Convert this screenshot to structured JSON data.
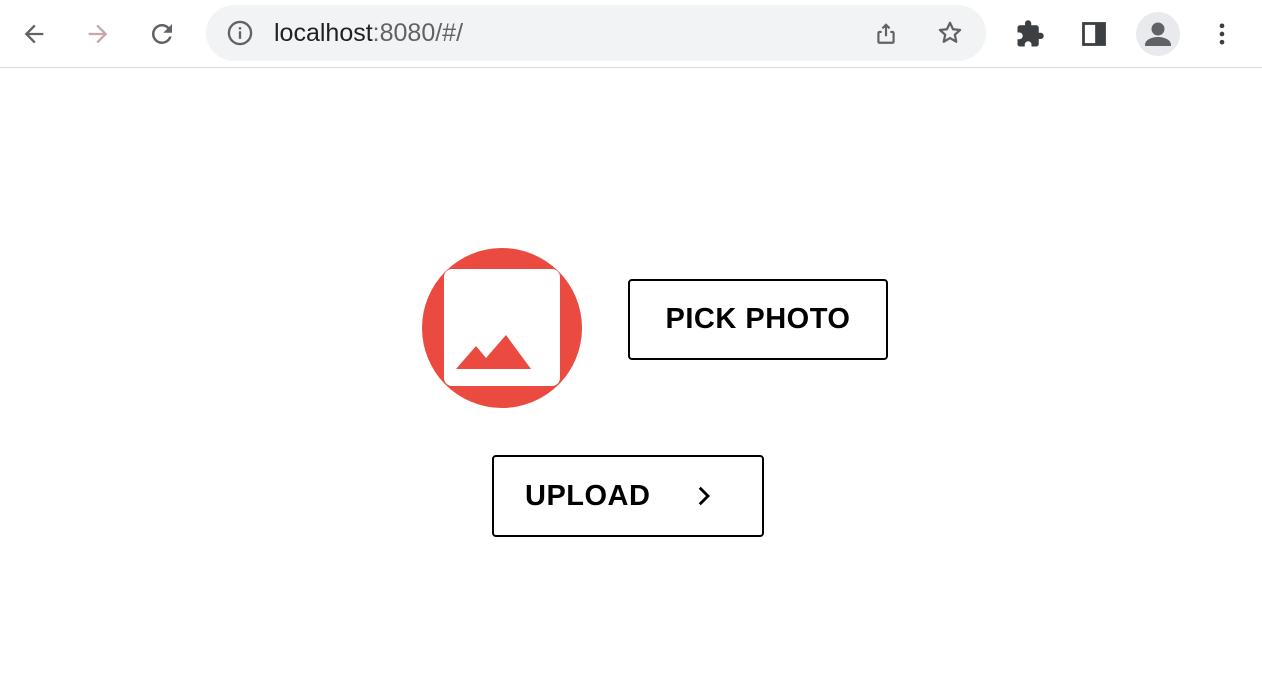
{
  "browser": {
    "url_host": "localhost",
    "url_path": ":8080/#/",
    "icons": {
      "back": "arrow-left-icon",
      "forward": "arrow-right-icon",
      "reload": "reload-icon",
      "site_info": "info-icon",
      "share": "share-icon",
      "bookmark": "star-icon",
      "extensions": "puzzle-icon",
      "side_panel": "side-panel-icon",
      "profile": "person-icon",
      "menu": "more-vertical-icon"
    }
  },
  "main": {
    "photo_placeholder_icon": "image-icon",
    "pick_photo_label": "PICK PHOTO",
    "upload_label": "UPLOAD",
    "upload_icon": "chevron-right-icon"
  },
  "colors": {
    "accent": "#ea4a3f",
    "forward_disabled": "#c9a7a7",
    "toolbar_icon": "#5f6368"
  }
}
